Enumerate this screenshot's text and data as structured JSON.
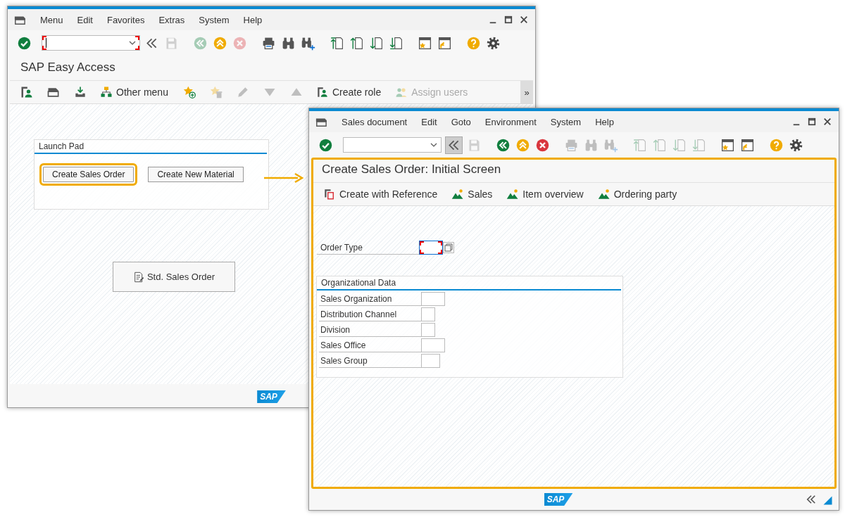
{
  "windows": [
    {
      "kind": "easy_access",
      "highlighted": false,
      "menu": [
        "Menu",
        "Edit",
        "Favorites",
        "Extras",
        "System",
        "Help"
      ],
      "command_field": {
        "focused": true
      },
      "toolbar": [
        {
          "kind": "enter",
          "disabled": false
        },
        {
          "kind": "command-toggle",
          "disabled": false,
          "pressed": false
        },
        {
          "kind": "save",
          "disabled": true
        },
        {
          "kind": "back",
          "disabled": true
        },
        {
          "kind": "exit",
          "disabled": false
        },
        {
          "kind": "cancel",
          "disabled": true
        },
        {
          "kind": "print",
          "disabled": false
        },
        {
          "kind": "find",
          "disabled": false
        },
        {
          "kind": "find-next",
          "disabled": false
        },
        {
          "kind": "first-page",
          "disabled": false
        },
        {
          "kind": "prev-page",
          "disabled": false
        },
        {
          "kind": "next-page",
          "disabled": false
        },
        {
          "kind": "last-page",
          "disabled": false
        },
        {
          "kind": "new-session",
          "disabled": false
        },
        {
          "kind": "shortcut",
          "disabled": false
        },
        {
          "kind": "help",
          "disabled": false
        },
        {
          "kind": "settings",
          "disabled": false
        }
      ],
      "title": "SAP Easy Access",
      "app_toolbar": [
        {
          "kind": "user-menu",
          "disabled": false
        },
        {
          "kind": "sap-menu",
          "disabled": false
        },
        {
          "kind": "download",
          "disabled": false
        },
        {
          "kind": "hierarchy",
          "label": "Other menu",
          "disabled": false
        },
        {
          "kind": "add-favorite",
          "disabled": false
        },
        {
          "kind": "delete-favorite",
          "disabled": true
        },
        {
          "kind": "edit",
          "disabled": true
        },
        {
          "kind": "move-down",
          "disabled": true
        },
        {
          "kind": "move-up",
          "disabled": true
        },
        {
          "kind": "create-role",
          "label": "Create role",
          "disabled": false
        },
        {
          "kind": "assign-users",
          "label": "Assign users",
          "disabled": true
        }
      ],
      "overflow": "»",
      "launch_pad": {
        "title": "Launch Pad",
        "buttons": [
          {
            "label": "Create Sales Order",
            "highlighted": true
          },
          {
            "label": "Create New Material",
            "highlighted": false
          }
        ]
      },
      "shortcut_button": {
        "label": "Std. Sales Order"
      },
      "status_bar": {
        "logo": "SAP",
        "nav": false
      }
    },
    {
      "kind": "sales_order",
      "highlighted": true,
      "menu": [
        "Sales document",
        "Edit",
        "Goto",
        "Environment",
        "System",
        "Help"
      ],
      "command_field": {
        "focused": false
      },
      "toolbar": [
        {
          "kind": "enter",
          "disabled": false
        },
        {
          "kind": "command-toggle",
          "disabled": false,
          "pressed": true
        },
        {
          "kind": "save",
          "disabled": true
        },
        {
          "kind": "back",
          "disabled": false
        },
        {
          "kind": "exit",
          "disabled": false
        },
        {
          "kind": "cancel",
          "disabled": false
        },
        {
          "kind": "print",
          "disabled": true
        },
        {
          "kind": "find",
          "disabled": true
        },
        {
          "kind": "find-next",
          "disabled": true
        },
        {
          "kind": "first-page",
          "disabled": true
        },
        {
          "kind": "prev-page",
          "disabled": true
        },
        {
          "kind": "next-page",
          "disabled": true
        },
        {
          "kind": "last-page",
          "disabled": true
        },
        {
          "kind": "new-session",
          "disabled": false
        },
        {
          "kind": "shortcut",
          "disabled": false
        },
        {
          "kind": "help",
          "disabled": false
        },
        {
          "kind": "settings",
          "disabled": false
        }
      ],
      "title": "Create Sales Order: Initial Screen",
      "app_toolbar": [
        {
          "kind": "copy",
          "label": "Create with Reference",
          "disabled": false
        },
        {
          "kind": "mountain",
          "label": "Sales",
          "disabled": false
        },
        {
          "kind": "mountain",
          "label": "Item overview",
          "disabled": false
        },
        {
          "kind": "mountain",
          "label": "Ordering party",
          "disabled": false
        }
      ],
      "order_type": {
        "label": "Order Type",
        "focused": true
      },
      "group": {
        "title": "Organizational Data",
        "fields": [
          {
            "label": "Sales Organization"
          },
          {
            "label": "Distribution Channel"
          },
          {
            "label": "Division"
          },
          {
            "label": "Sales Office"
          },
          {
            "label": "Sales Group"
          }
        ]
      },
      "status_bar": {
        "logo": "SAP",
        "nav": true
      }
    }
  ]
}
